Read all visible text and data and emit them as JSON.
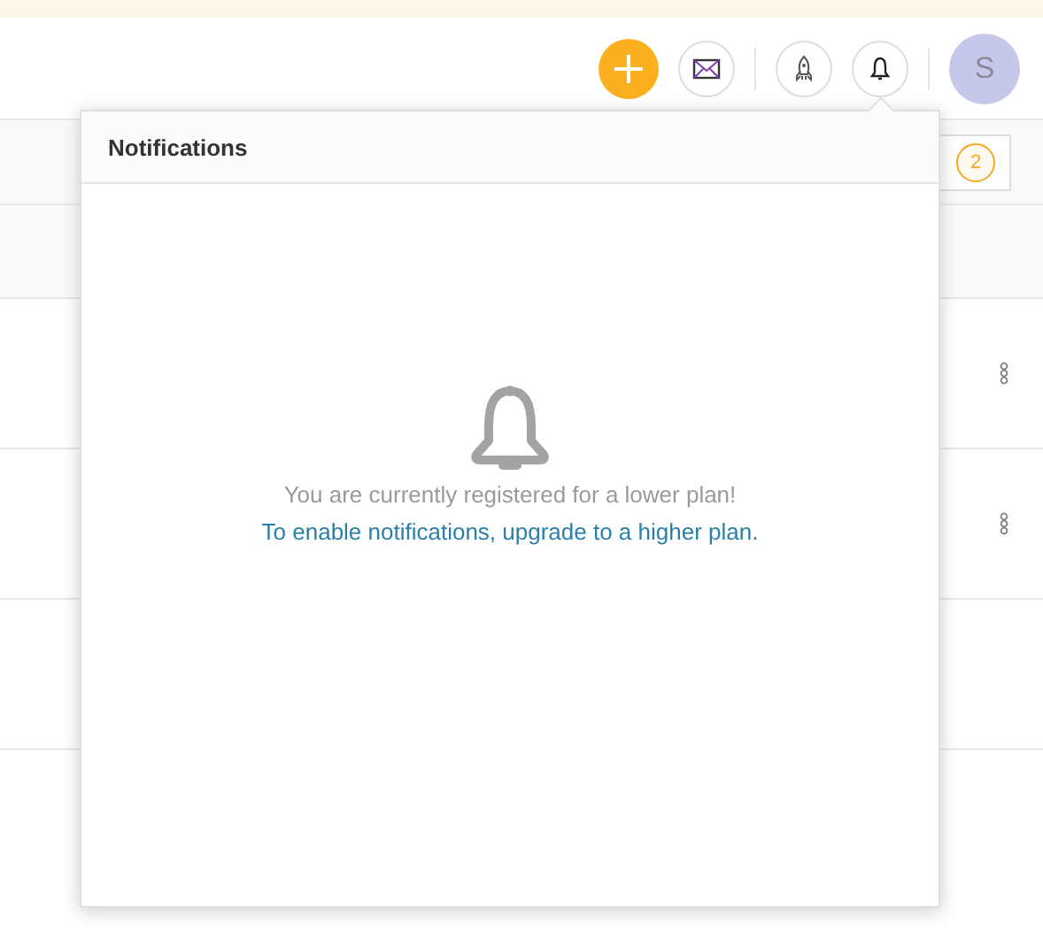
{
  "header": {
    "avatar": "S"
  },
  "toolbar": {
    "filter_count": "2"
  },
  "table": {
    "rows": [
      {
        "has_menu": true
      },
      {
        "has_menu": true
      },
      {
        "has_menu": false
      }
    ]
  },
  "notifications": {
    "title": "Notifications",
    "message": "You are currently registered for a lower plan!",
    "link": "To enable notifications, upgrade to a higher plan."
  }
}
